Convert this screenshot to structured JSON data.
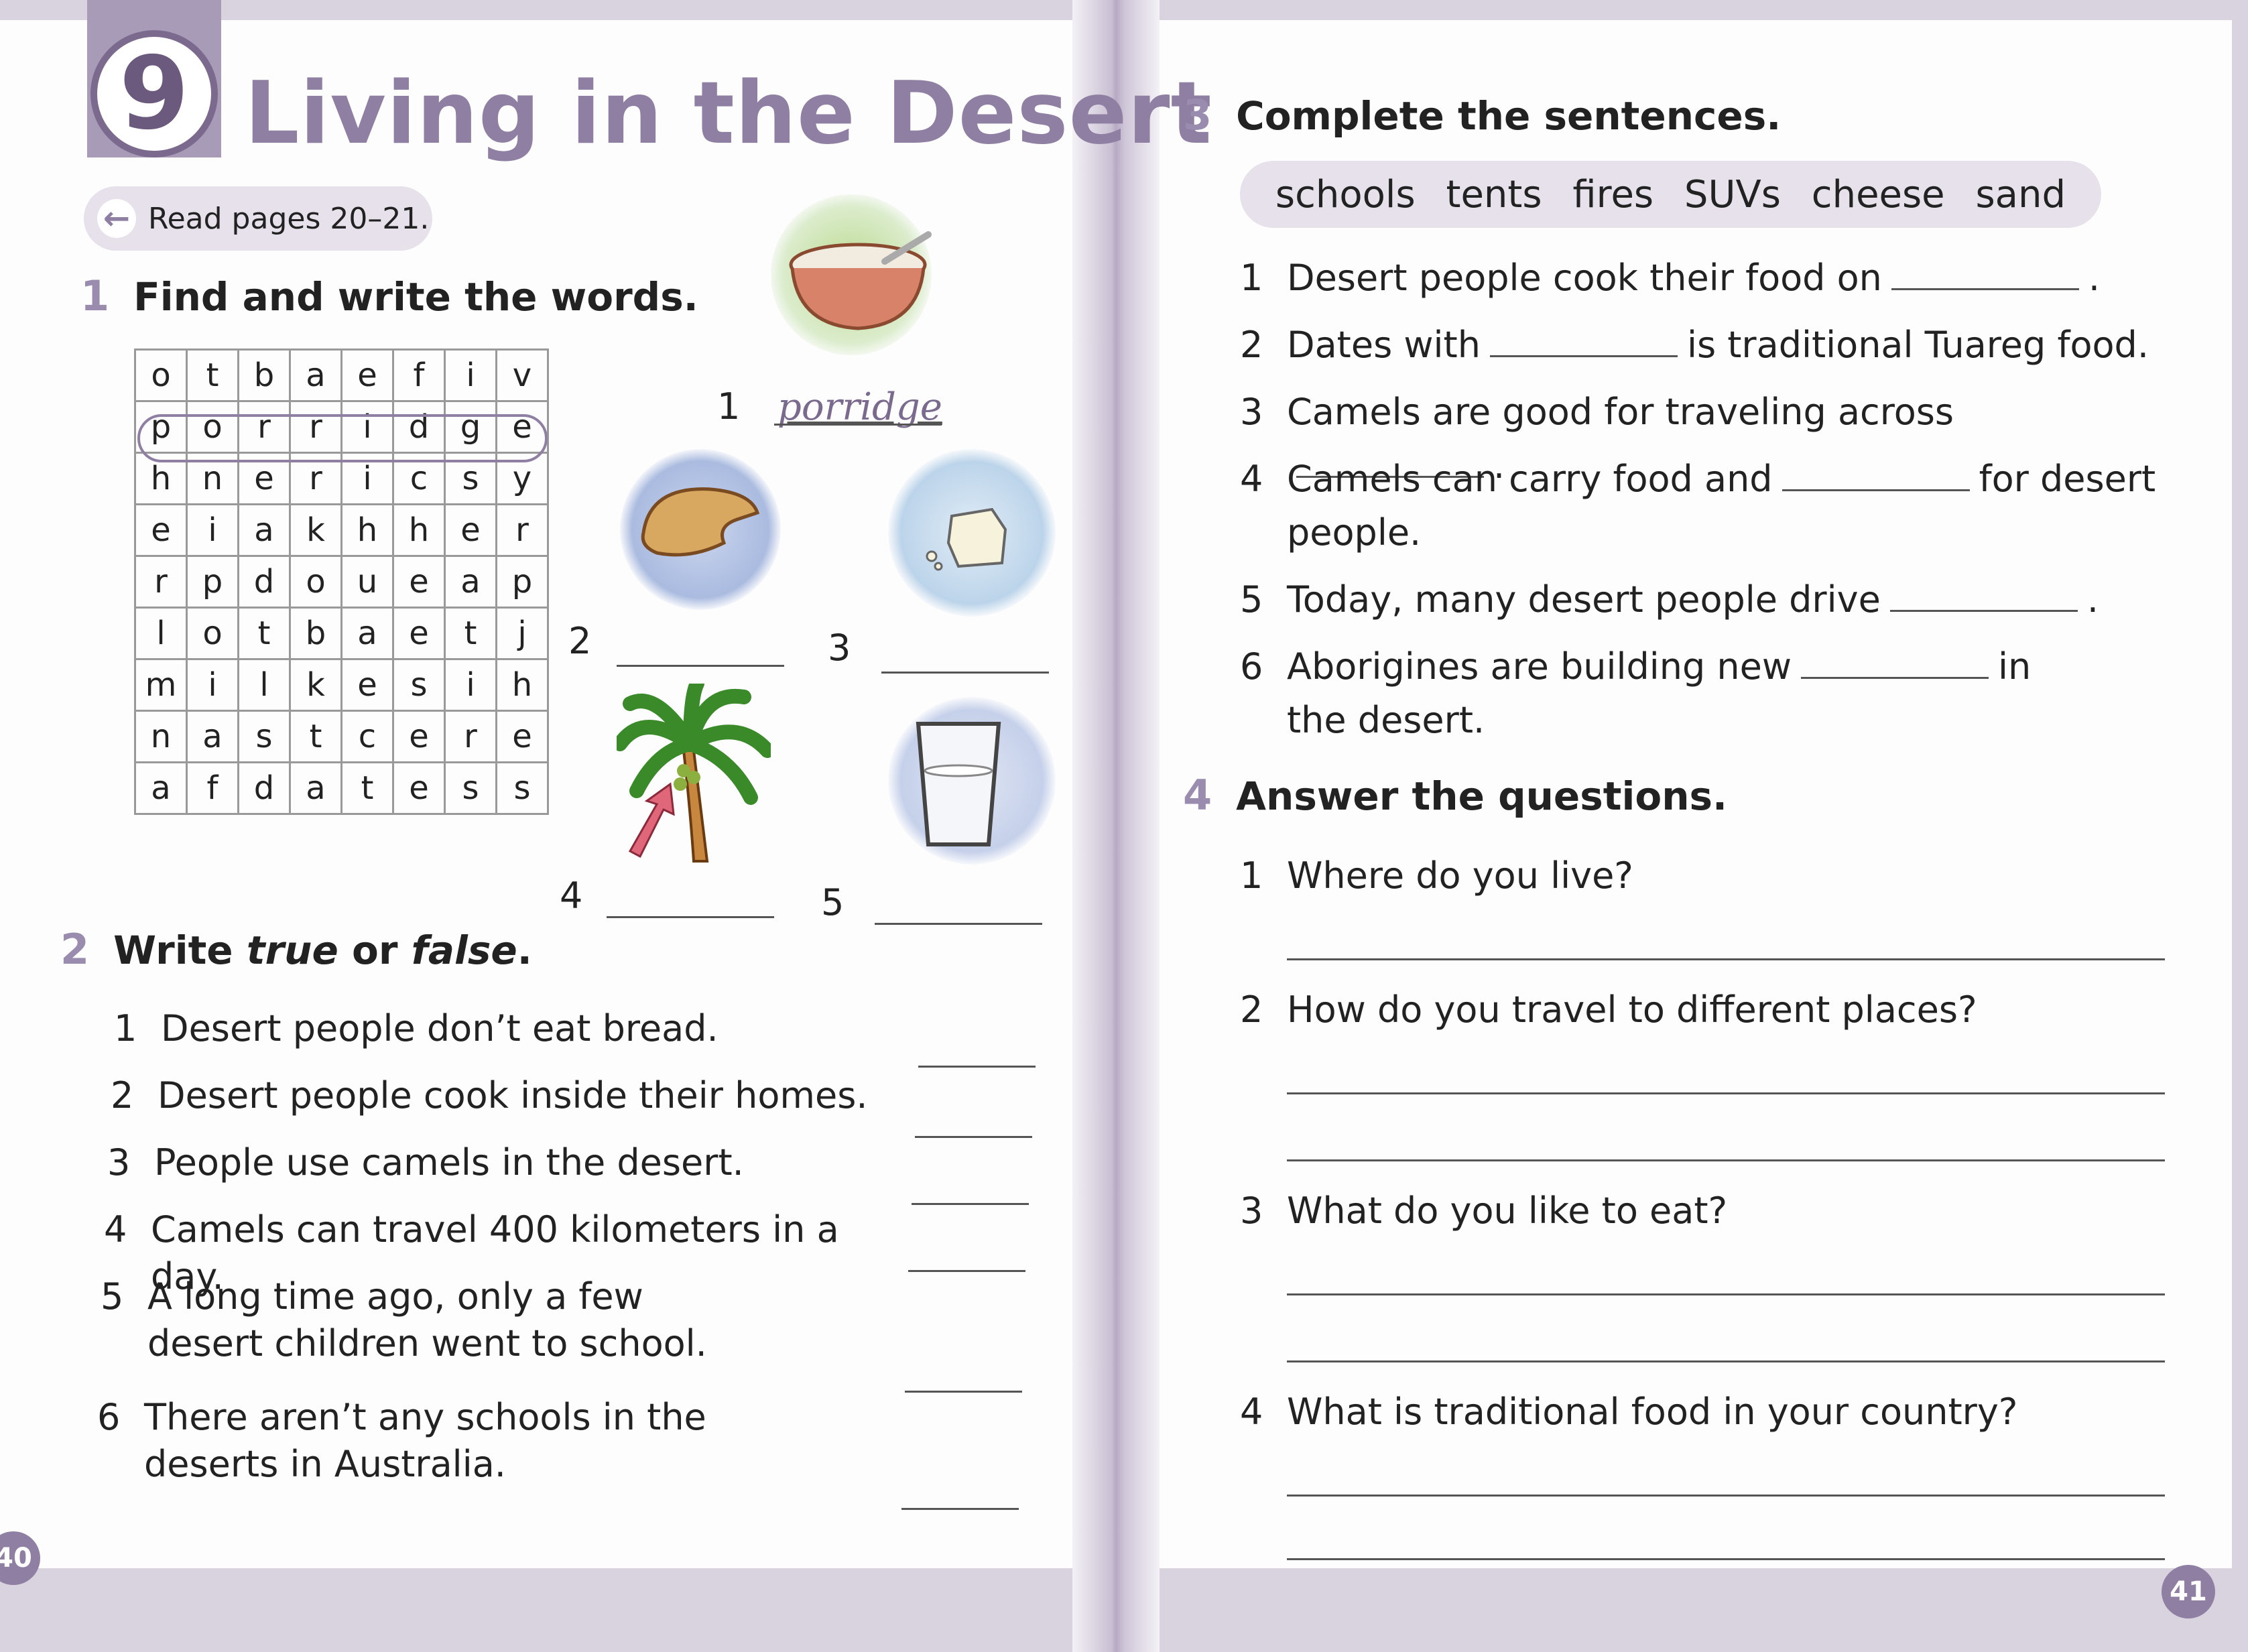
{
  "left_page": {
    "unit_number": "9",
    "unit_title": "Living in the Desert",
    "read_pages": "Read pages 20–21.",
    "page_number": "40",
    "section1": {
      "number": "1",
      "title": "Find and write the words.",
      "grid": [
        [
          "o",
          "t",
          "b",
          "a",
          "e",
          "f",
          "i",
          "v"
        ],
        [
          "p",
          "o",
          "r",
          "r",
          "i",
          "d",
          "g",
          "e"
        ],
        [
          "h",
          "n",
          "e",
          "r",
          "i",
          "c",
          "s",
          "y"
        ],
        [
          "e",
          "i",
          "a",
          "k",
          "h",
          "h",
          "e",
          "r"
        ],
        [
          "r",
          "p",
          "d",
          "o",
          "u",
          "e",
          "a",
          "p"
        ],
        [
          "l",
          "o",
          "t",
          "b",
          "a",
          "e",
          "t",
          "j"
        ],
        [
          "m",
          "i",
          "l",
          "k",
          "e",
          "s",
          "i",
          "h"
        ],
        [
          "n",
          "a",
          "s",
          "t",
          "c",
          "e",
          "r",
          "e"
        ],
        [
          "a",
          "f",
          "d",
          "a",
          "t",
          "e",
          "s",
          "s"
        ]
      ],
      "pictures": [
        {
          "num": "1",
          "answer": "porridge",
          "icon": "porridge-bowl-icon"
        },
        {
          "num": "2",
          "answer": "",
          "icon": "bread-icon"
        },
        {
          "num": "3",
          "answer": "",
          "icon": "cheese-icon"
        },
        {
          "num": "4",
          "answer": "",
          "icon": "date-palm-icon"
        },
        {
          "num": "5",
          "answer": "",
          "icon": "milk-glass-icon"
        }
      ]
    },
    "section2": {
      "number": "2",
      "title_pre": "Write ",
      "title_true": "true",
      "title_mid": " or ",
      "title_false": "false",
      "title_end": ".",
      "items": [
        {
          "num": "1",
          "text": "Desert people don’t eat bread."
        },
        {
          "num": "2",
          "text": "Desert people cook inside their homes."
        },
        {
          "num": "3",
          "text": "People use camels in the desert."
        },
        {
          "num": "4",
          "text": "Camels can travel 400 kilometers in a day."
        },
        {
          "num": "5",
          "text": "A long time ago, only a few desert children went to school."
        },
        {
          "num": "6",
          "text": "There aren’t any schools in the deserts in Australia."
        }
      ]
    }
  },
  "right_page": {
    "page_number": "41",
    "section3": {
      "number": "3",
      "title": "Complete the sentences.",
      "word_bank": [
        "schools",
        "tents",
        "fires",
        "SUVs",
        "cheese",
        "sand"
      ],
      "items": [
        {
          "num": "1",
          "before": "Desert people cook their food on",
          "after": "."
        },
        {
          "num": "2",
          "before": "Dates with",
          "after": "is traditional Tuareg food."
        },
        {
          "num": "3",
          "before": "Camels are good for traveling across",
          "after": "."
        },
        {
          "num": "4",
          "before": "Camels can carry food and",
          "after": "for desert people."
        },
        {
          "num": "5",
          "before": "Today, many desert people drive",
          "after": "."
        },
        {
          "num": "6",
          "before": "Aborigines are building new",
          "after": "in the desert."
        }
      ]
    },
    "section4": {
      "number": "4",
      "title": "Answer the questions.",
      "items": [
        {
          "num": "1",
          "text": "Where do you live?"
        },
        {
          "num": "2",
          "text": "How do you travel to different places?"
        },
        {
          "num": "3",
          "text": "What do you like to eat?"
        },
        {
          "num": "4",
          "text": "What is traditional food in your country?"
        }
      ]
    }
  }
}
